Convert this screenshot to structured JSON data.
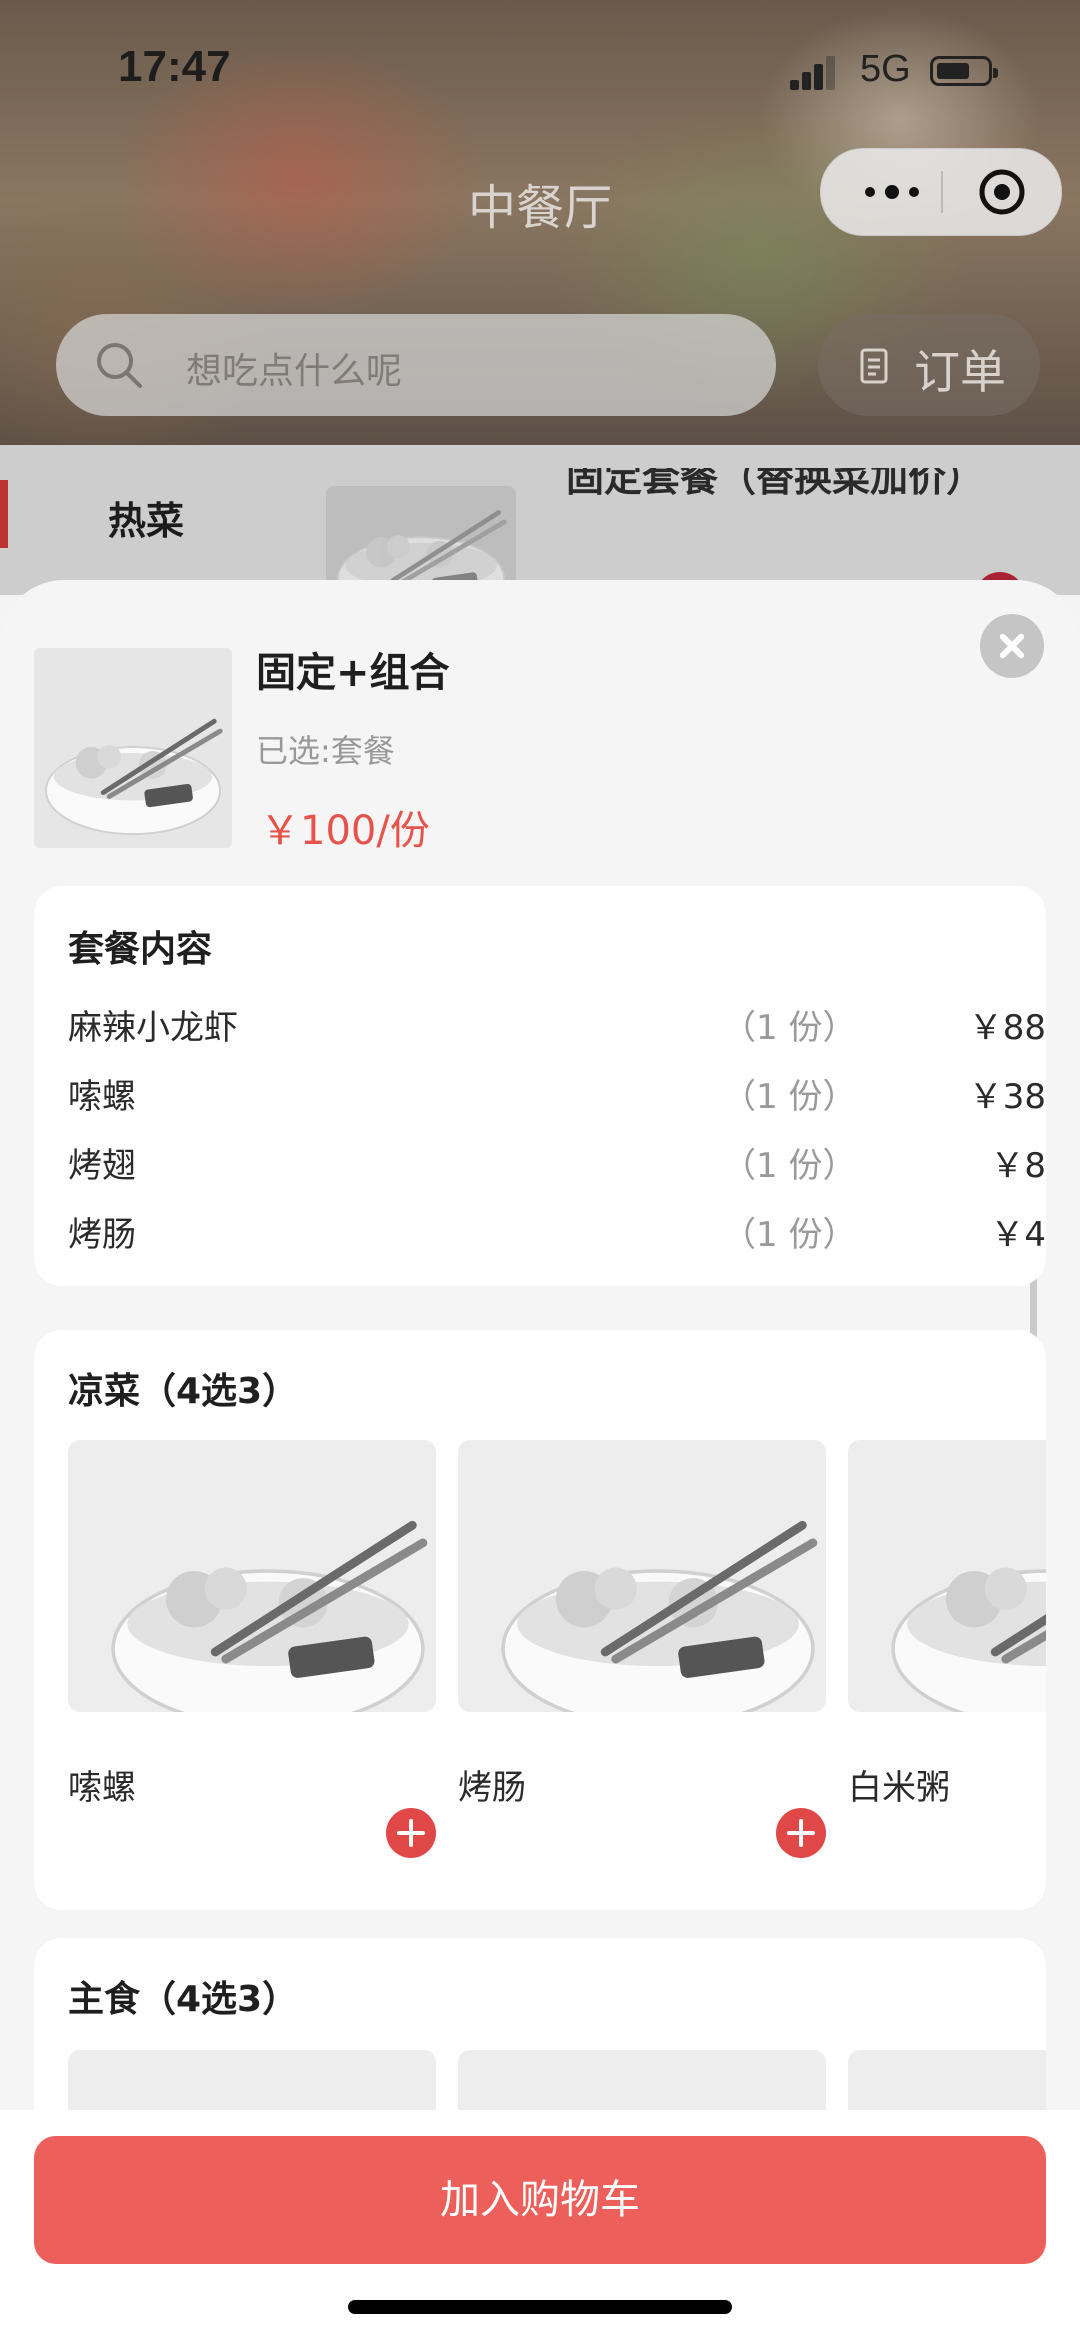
{
  "status_bar": {
    "time": "17:47",
    "network": "5G"
  },
  "header": {
    "title": "中餐厅"
  },
  "search": {
    "placeholder": "想吃点什么呢"
  },
  "order_button": {
    "label": "订单"
  },
  "background": {
    "category": "热菜",
    "item_title": "固定套餐（替换菜加价）"
  },
  "product": {
    "name": "固定+组合",
    "selected": "已选:套餐",
    "price": "￥100/份"
  },
  "set_menu": {
    "title": "套餐内容",
    "items": [
      {
        "name": "麻辣小龙虾",
        "qty": "（1 份）",
        "price": "￥88"
      },
      {
        "name": "嗦螺",
        "qty": "（1 份）",
        "price": "￥38"
      },
      {
        "name": "烤翅",
        "qty": "（1 份）",
        "price": "￥8"
      },
      {
        "name": "烤肠",
        "qty": "（1 份）",
        "price": "￥4"
      }
    ]
  },
  "cold_dishes": {
    "title": "凉菜（4选3）",
    "items": [
      {
        "name": "嗦螺"
      },
      {
        "name": "烤肠"
      },
      {
        "name": "白米粥"
      }
    ]
  },
  "staple": {
    "title": "主食（4选3）"
  },
  "cart_button": {
    "label": "加入购物车"
  },
  "colors": {
    "accent": "#e5534b",
    "button": "#ec5f5a",
    "add": "#e04848"
  }
}
